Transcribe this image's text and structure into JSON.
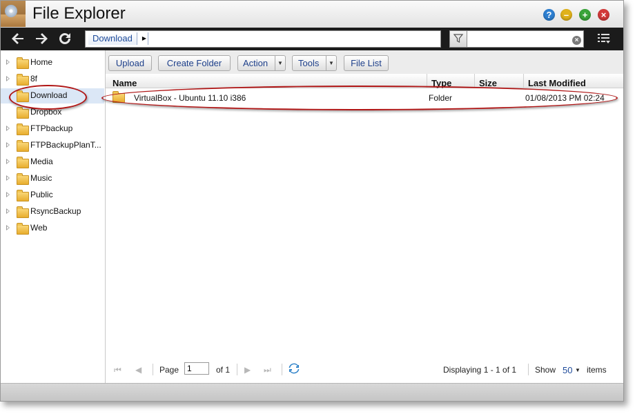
{
  "window": {
    "title": "File Explorer",
    "controls": {
      "help": "?",
      "minimize": "–",
      "maximize": "+",
      "close": "×"
    }
  },
  "toolbar": {
    "back_icon": "back-arrow-icon",
    "forward_icon": "forward-arrow-icon",
    "refresh_icon": "refresh-icon",
    "breadcrumb": [
      "Download"
    ],
    "search_value": "",
    "filter_icon": "funnel-icon",
    "view_icon": "list-view-icon"
  },
  "sidebar": {
    "items": [
      {
        "label": "Home",
        "expandable": true
      },
      {
        "label": "8f",
        "expandable": true
      },
      {
        "label": "Download",
        "expandable": false,
        "selected": true
      },
      {
        "label": "Dropbox",
        "expandable": false
      },
      {
        "label": "FTPbackup",
        "expandable": true
      },
      {
        "label": "FTPBackupPlanT...",
        "expandable": true
      },
      {
        "label": "Media",
        "expandable": true
      },
      {
        "label": "Music",
        "expandable": true
      },
      {
        "label": "Public",
        "expandable": true
      },
      {
        "label": "RsyncBackup",
        "expandable": true
      },
      {
        "label": "Web",
        "expandable": true
      }
    ]
  },
  "actions": {
    "upload": "Upload",
    "create_folder": "Create Folder",
    "action": "Action",
    "tools": "Tools",
    "file_list": "File List"
  },
  "grid": {
    "columns": [
      "Name",
      "Type",
      "Size",
      "Last Modified"
    ],
    "rows": [
      {
        "name": "VirtualBox - Ubuntu 11.10 i386",
        "type": "Folder",
        "size": "",
        "modified": "01/08/2013 PM 02:24"
      }
    ]
  },
  "pager": {
    "page_label": "Page",
    "page_value": "1",
    "of_label": "of 1",
    "displaying": "Displaying 1 - 1 of 1",
    "show_label": "Show",
    "per_page": "50",
    "items_label": "items"
  },
  "annotation_color": "#b01515"
}
